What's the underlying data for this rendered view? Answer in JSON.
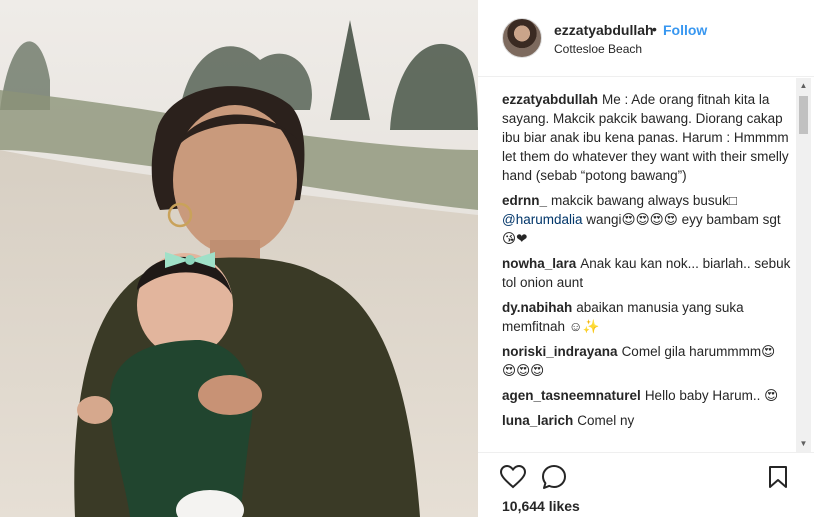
{
  "post": {
    "username": "ezzatyabdullah",
    "separator": "•",
    "follow_label": "Follow",
    "location": "Cottesloe Beach",
    "likes": "10,644 likes"
  },
  "comments": [
    {
      "user": "ezzatyabdullah",
      "text": "Me : Ade orang fitnah kita la sayang. Makcik pakcik bawang. Diorang cakap ibu biar anak ibu kena panas. Harum : Hmmmm let them do whatever they want with their smelly hand (sebab “potong bawang”)"
    },
    {
      "user": "edrnn_",
      "text": "makcik bawang always busuk□",
      "mention": "@harumdalia",
      "text2": "wangi😍😍😍😍 eyy bambam sgt😘❤"
    },
    {
      "user": "nowha_lara",
      "text": "Anak kau kan nok... biarlah.. sebuk tol onion aunt"
    },
    {
      "user": "dy.nabihah",
      "text": "abaikan manusia yang suka memfitnah ☺✨"
    },
    {
      "user": "noriski_indrayana",
      "text": "Comel gila harummmm😍 😍😍😍"
    },
    {
      "user": "agen_tasneemnaturel",
      "text": "Hello baby Harum.. 😍"
    },
    {
      "user": "luna_larich",
      "text": "Comel ny"
    }
  ],
  "icons": {
    "like": "heart-outline-icon",
    "comment": "speech-bubble-icon",
    "save": "bookmark-icon"
  },
  "colors": {
    "follow": "#3897f0",
    "mention": "#003569",
    "text": "#262626"
  }
}
